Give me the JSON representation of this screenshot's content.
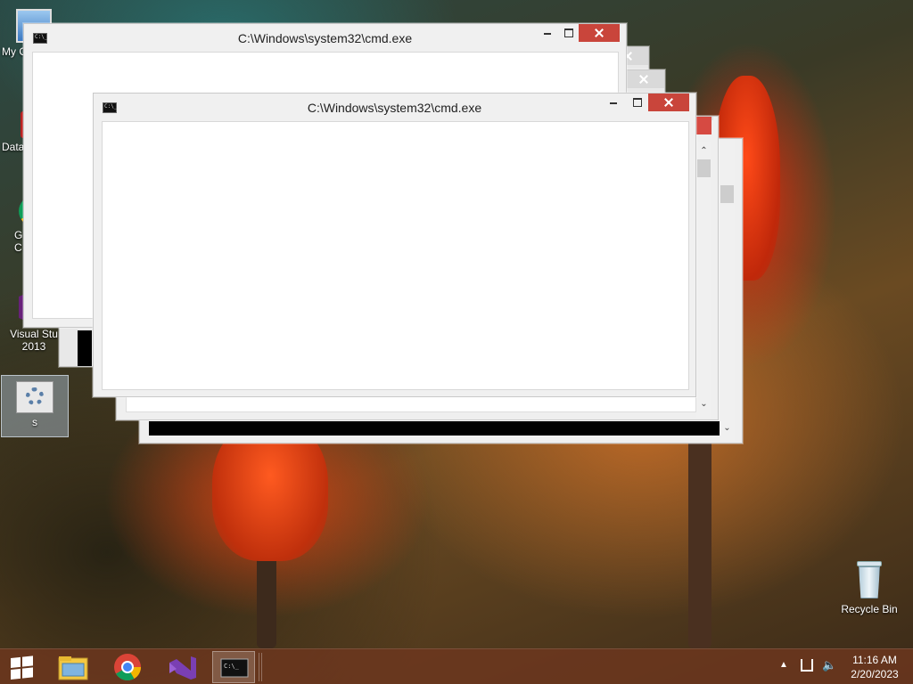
{
  "desktop": {
    "icons": [
      {
        "label": "My C"
      },
      {
        "label": "Data"
      },
      {
        "label": "G\nC"
      },
      {
        "label": "Visual Stu\n2013"
      },
      {
        "label": "s"
      },
      {
        "label": "Recycle Bin"
      }
    ]
  },
  "windows": [
    {
      "title": "C:\\Windows\\system32\\cmd.exe"
    },
    {
      "title": "C:\\Windows\\system32\\cmd.exe"
    }
  ],
  "taskbar": {
    "apps": [
      {
        "name": "start-button"
      },
      {
        "name": "file-explorer"
      },
      {
        "name": "chrome"
      },
      {
        "name": "visual-studio"
      },
      {
        "name": "command-prompt"
      }
    ],
    "clock": {
      "time": "11:16 AM",
      "date": "2/20/2023"
    }
  },
  "colors": {
    "close": "#c9453b",
    "taskbar": "#6e371e"
  }
}
